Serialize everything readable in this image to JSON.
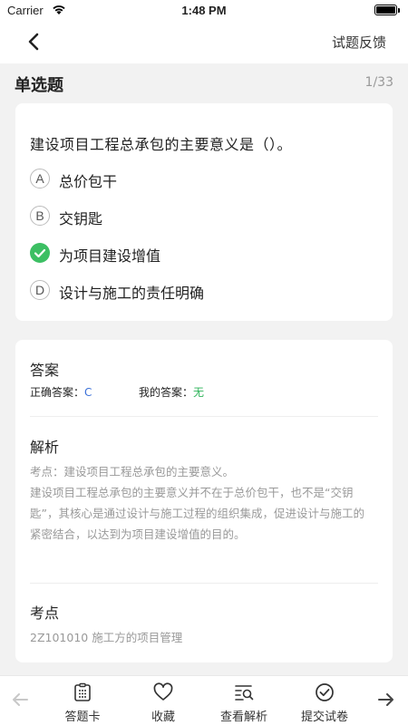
{
  "status": {
    "carrier": "Carrier",
    "time": "1:48 PM"
  },
  "nav": {
    "feedback": "试题反馈"
  },
  "question": {
    "type": "单选题",
    "counter": "1/33",
    "stem": "建设项目工程总承包的主要意义是（）。",
    "options": [
      {
        "letter": "A",
        "text": "总价包干"
      },
      {
        "letter": "B",
        "text": "交钥匙"
      },
      {
        "letter": "C",
        "text": "为项目建设增值",
        "selected_correct": true
      },
      {
        "letter": "D",
        "text": "设计与施工的责任明确"
      }
    ]
  },
  "answer": {
    "title": "答案",
    "correct_label": "正确答案：",
    "correct_value": "C",
    "mine_label": "我的答案：",
    "mine_value": "无",
    "analysis_title": "解析",
    "analysis_line1": "考点：建设项目工程总承包的主要意义。",
    "analysis_line2": "建设项目工程总承包的主要意义并不在于总价包干，也不是“交钥",
    "analysis_line3": "匙”，其核心是通过设计与施工过程的组织集成，促进设计与施工的",
    "analysis_line4": "紧密结合，以达到为项目建设增值的目的。",
    "kpoint_title": "考点",
    "kpoint_value": "2Z101010 施工方的项目管理"
  },
  "tabbar": {
    "tabs": [
      {
        "label": "答题卡",
        "icon": "answer-sheet-icon"
      },
      {
        "label": "收藏",
        "icon": "heart-icon"
      },
      {
        "label": "查看解析",
        "icon": "search-list-icon"
      },
      {
        "label": "提交试卷",
        "icon": "check-circle-icon"
      }
    ]
  },
  "colors": {
    "correct_green": "#3cbf63",
    "correct_answer_blue": "#3a6fd8",
    "my_answer_green": "#2eb35a"
  }
}
